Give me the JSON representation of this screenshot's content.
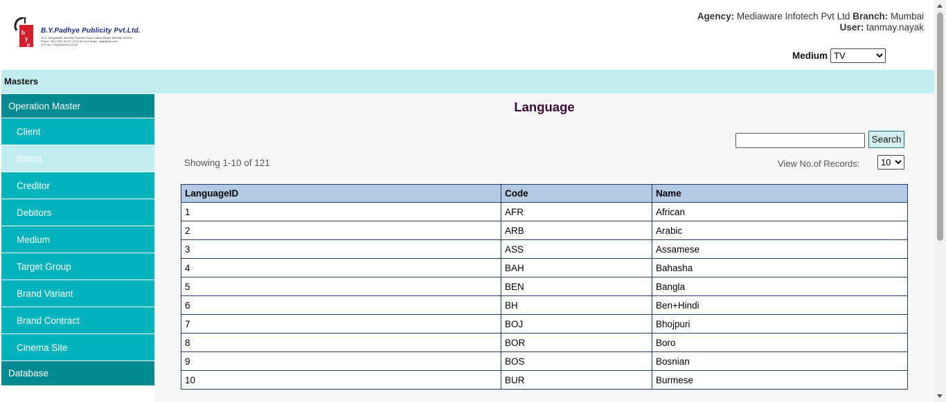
{
  "header": {
    "logo": {
      "icon": "bp-logo-mark",
      "company": "B.Y.Padhye Publicity Pvt.Ltd.",
      "address_lines": [
        "32 E, Shivganesh, Bhavani Shankar Road, Dadar (West), Mumbai 400028.",
        "Phone : 022 2422 06 45 / 2422 02 41  ● Email : vijay@byp.com",
        "GST No. 27AAACB1871Q1Z2"
      ]
    },
    "agency_label": "Agency:",
    "agency_value": "Mediaware Infotech Pvt Ltd",
    "branch_label": "Branch:",
    "branch_value": "Mumbai",
    "user_label": "User:",
    "user_value": "tanmay.nayak",
    "medium_label": "Medium",
    "medium_value": "TV"
  },
  "masters_bar": {
    "label": "Masters"
  },
  "sidebar": {
    "section": "Operation Master",
    "items": [
      {
        "label": "Client",
        "active": false
      },
      {
        "label": "Brand",
        "active": true
      },
      {
        "label": "Creditor",
        "active": false
      },
      {
        "label": "Debitors",
        "active": false
      },
      {
        "label": "Medium",
        "active": false
      },
      {
        "label": "Target Group",
        "active": false
      },
      {
        "label": "Brand Variant",
        "active": false
      },
      {
        "label": "Brand Contract",
        "active": false
      },
      {
        "label": "Cinema Site",
        "active": false
      }
    ],
    "footer": "Database"
  },
  "main": {
    "title": "Language",
    "search_value": "",
    "search_button": "Search",
    "showing": "Showing 1-10 of 121",
    "view_records_label": "View No.of Records:",
    "records_value": "10",
    "columns": [
      "LanguageID",
      "Code",
      "Name"
    ],
    "rows": [
      [
        "1",
        "AFR",
        "African"
      ],
      [
        "2",
        "ARB",
        "Arabic"
      ],
      [
        "3",
        "ASS",
        "Assamese"
      ],
      [
        "4",
        "BAH",
        "Bahasha"
      ],
      [
        "5",
        "BEN",
        "Bangla"
      ],
      [
        "6",
        "BH",
        "Ben+Hindi"
      ],
      [
        "7",
        "BOJ",
        "Bhojpuri"
      ],
      [
        "8",
        "BOR",
        "Boro"
      ],
      [
        "9",
        "BOS",
        "Bosnian"
      ],
      [
        "10",
        "BUR",
        "Burmese"
      ]
    ]
  },
  "colors": {
    "masters_bar": "#c1edf0",
    "sidebar_header": "#008b93",
    "sidebar_item": "#00b3bd",
    "table_header": "#b4c9e4",
    "title": "#3a0a3a"
  }
}
